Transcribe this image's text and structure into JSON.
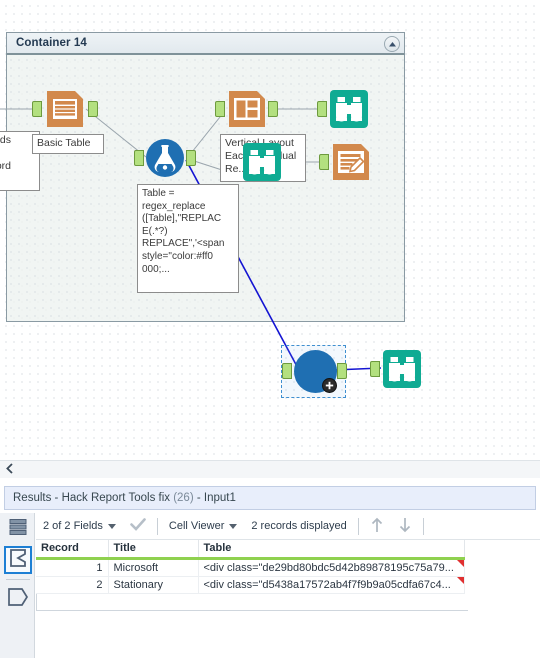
{
  "canvas": {
    "container": {
      "title": "Container 14",
      "collapse_icon": "chevron-up-icon"
    },
    "nodes": [
      {
        "id": "basic-table",
        "icon": "table-icon",
        "label": "Basic Table"
      },
      {
        "id": "vertical-layout",
        "icon": "layout-icon",
        "label": "Vertical Layout\nEach Individual\nRe..."
      },
      {
        "id": "formula",
        "icon": "flask-icon",
        "label": ""
      },
      {
        "id": "browse-top",
        "icon": "binoculars-icon",
        "label": ""
      },
      {
        "id": "browse-mid",
        "icon": "binoculars-icon",
        "label": ""
      },
      {
        "id": "render",
        "icon": "report-pencil-icon",
        "label": ""
      },
      {
        "id": "selected-tool",
        "icon": "blue-circle-icon",
        "label": "",
        "badge": "plus-icon"
      },
      {
        "id": "browse-bottom",
        "icon": "binoculars-icon",
        "label": ""
      }
    ],
    "clipped_label": "words\nce\nyword",
    "annotation": "Table =\nregex_replace\n([Table],\"REPLAC\nE(.*?)\nREPLACE\",'<span\nstyle=\"color:#ff0\n000;..."
  },
  "results": {
    "title_main": "Results - Hack Report Tools fix ",
    "title_count": "(26)",
    "title_suffix": " - Input1",
    "toolbar": {
      "fields_label": "2 of 2 Fields",
      "check_icon": "check-icon",
      "viewer_label": "Cell Viewer",
      "records_label": "2 records displayed",
      "up_icon": "arrow-up-icon",
      "down_icon": "arrow-down-icon"
    },
    "rail": [
      {
        "id": "data-icon",
        "active": false
      },
      {
        "id": "sigma-icon",
        "active": true
      },
      {
        "id": "metadata-icon",
        "active": false
      }
    ],
    "grid": {
      "columns": [
        "Record",
        "Title",
        "Table"
      ],
      "rows": [
        {
          "record": "1",
          "title": "Microsoft",
          "table": "<div class=\"de29bd80bdc5d42b89878195c75a79..."
        },
        {
          "record": "2",
          "title": "Stationary",
          "table": "<div class=\"d5438a17572ab4f7f9b9a05cdfa67c4..."
        }
      ]
    }
  },
  "colors": {
    "node_orange": "#d2894c",
    "node_teal": "#0fab93",
    "node_blue": "#1f6fb2",
    "anchor_green": "#b3e07f",
    "wire_blue": "#1414d2",
    "header_blue": "#243a52",
    "grid_accent": "#8fd14f"
  }
}
